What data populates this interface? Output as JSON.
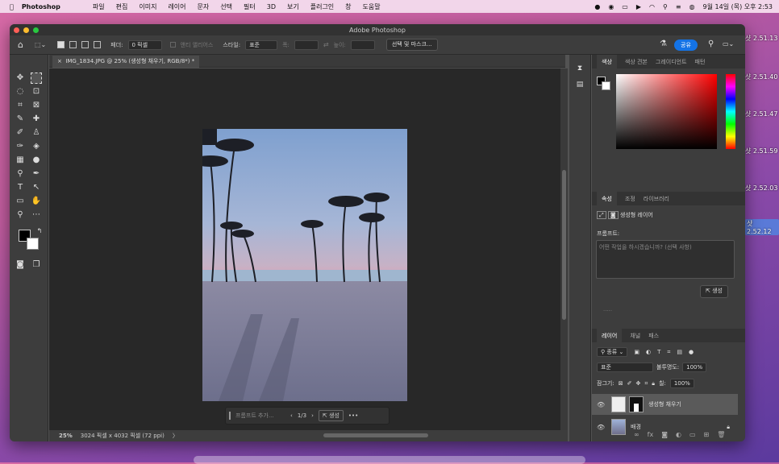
{
  "menubar": {
    "app": "Photoshop",
    "items": [
      "파일",
      "편집",
      "이미지",
      "레이어",
      "문자",
      "선택",
      "필터",
      "3D",
      "보기",
      "플러그인",
      "창",
      "도움말"
    ],
    "clock": "9월 14일 (목) 오후 2:53"
  },
  "desktop": {
    "items": [
      {
        "label": "샷",
        "time": "2.51.13"
      },
      {
        "label": "샷",
        "time": "2.51.40"
      },
      {
        "label": "샷",
        "time": "2.51.47"
      },
      {
        "label": "샷",
        "time": "2.51.59"
      },
      {
        "label": "샷",
        "time": "2.52.03"
      },
      {
        "label": "샷",
        "time": "2.52.12"
      }
    ]
  },
  "window": {
    "title": "Adobe Photoshop"
  },
  "options": {
    "feather_label": "페더:",
    "feather_value": "0 픽셀",
    "antialias": "앤티 앨리어스",
    "style_label": "스타일:",
    "style_value": "표준",
    "width_label": "폭:",
    "height_label": "높이:",
    "select_mask": "선택 및 마스크...",
    "share": "공유"
  },
  "document": {
    "tab": "IMG_1834.JPG @ 25% (생성형 채우기, RGB/8*) *"
  },
  "genbar": {
    "placeholder": "프롬프트 추가...",
    "counter": "1/3",
    "generate": "생성",
    "more": "•••"
  },
  "status": {
    "zoom": "25%",
    "info": "3024 픽셀 x 4032 픽셀 (72 ppi)",
    "arrow": "〉"
  },
  "color_panel": {
    "tabs": [
      "색상",
      "색상 견본",
      "그레이디언트",
      "패턴"
    ]
  },
  "props_panel": {
    "tabs": [
      "속성",
      "조정",
      "라이브러리"
    ],
    "type": "생성형 레이어",
    "prompt_label": "프롬프트:",
    "prompt_placeholder": "어떤 작업을 하시겠습니까? (선택 사항)",
    "generate": "생성",
    "dots": "·····"
  },
  "layers_panel": {
    "tabs": [
      "레이어",
      "채널",
      "패스"
    ],
    "filter": "종류",
    "blend": "표준",
    "opacity_label": "불투명도:",
    "opacity": "100%",
    "lock_label": "잠그기:",
    "fill_label": "칠:",
    "fill": "100%",
    "layers": [
      {
        "name": "생성형 채우기",
        "selected": true
      },
      {
        "name": "배경",
        "selected": false
      }
    ]
  },
  "colors": {
    "accent": "#1473e6",
    "panel": "#3d3d3d",
    "canvas": "#282828"
  }
}
